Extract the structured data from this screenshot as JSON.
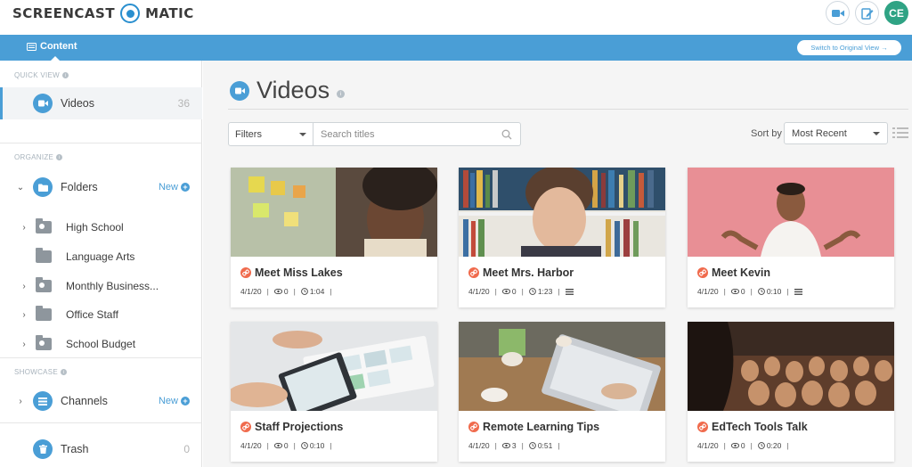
{
  "header": {
    "logo_left": "SCREENCAST",
    "logo_right": "MATIC",
    "avatar_initials": "CE"
  },
  "subbar": {
    "content_tab": "Content",
    "switch_button": "Switch to Original View →"
  },
  "sidebar": {
    "quick_view_label": "QUICK VIEW",
    "videos_label": "Videos",
    "videos_count": "36",
    "organize_label": "ORGANIZE",
    "folders_label": "Folders",
    "folders_new": "New",
    "folders": [
      {
        "label": "High School",
        "expandable": true,
        "shared": true
      },
      {
        "label": "Language Arts",
        "expandable": false,
        "shared": false
      },
      {
        "label": "Monthly Business...",
        "expandable": true,
        "shared": true
      },
      {
        "label": "Office Staff",
        "expandable": true,
        "shared": false
      },
      {
        "label": "School Budget",
        "expandable": true,
        "shared": true
      }
    ],
    "showcase_label": "SHOWCASE",
    "channels_label": "Channels",
    "channels_new": "New",
    "trash_label": "Trash",
    "trash_count": "0"
  },
  "main": {
    "page_title": "Videos",
    "filters_label": "Filters",
    "search_placeholder": "Search titles",
    "sort_label": "Sort by",
    "sort_value": "Most Recent"
  },
  "videos": [
    {
      "title": "Meet Miss Lakes",
      "date": "4/1/20",
      "views": "0",
      "duration": "1:04",
      "has_captions": false
    },
    {
      "title": "Meet Mrs. Harbor",
      "date": "4/1/20",
      "views": "0",
      "duration": "1:23",
      "has_captions": true
    },
    {
      "title": "Meet Kevin",
      "date": "4/1/20",
      "views": "0",
      "duration": "0:10",
      "has_captions": true
    },
    {
      "title": "Staff Projections",
      "date": "4/1/20",
      "views": "0",
      "duration": "0:10",
      "has_captions": false
    },
    {
      "title": "Remote Learning Tips",
      "date": "4/1/20",
      "views": "3",
      "duration": "0:51",
      "has_captions": false
    },
    {
      "title": "EdTech Tools Talk",
      "date": "4/1/20",
      "views": "0",
      "duration": "0:20",
      "has_captions": false
    }
  ],
  "colors": {
    "accent_blue": "#4a9ed6",
    "avatar_green": "#2fa384",
    "link_orange": "#f06b4d"
  }
}
